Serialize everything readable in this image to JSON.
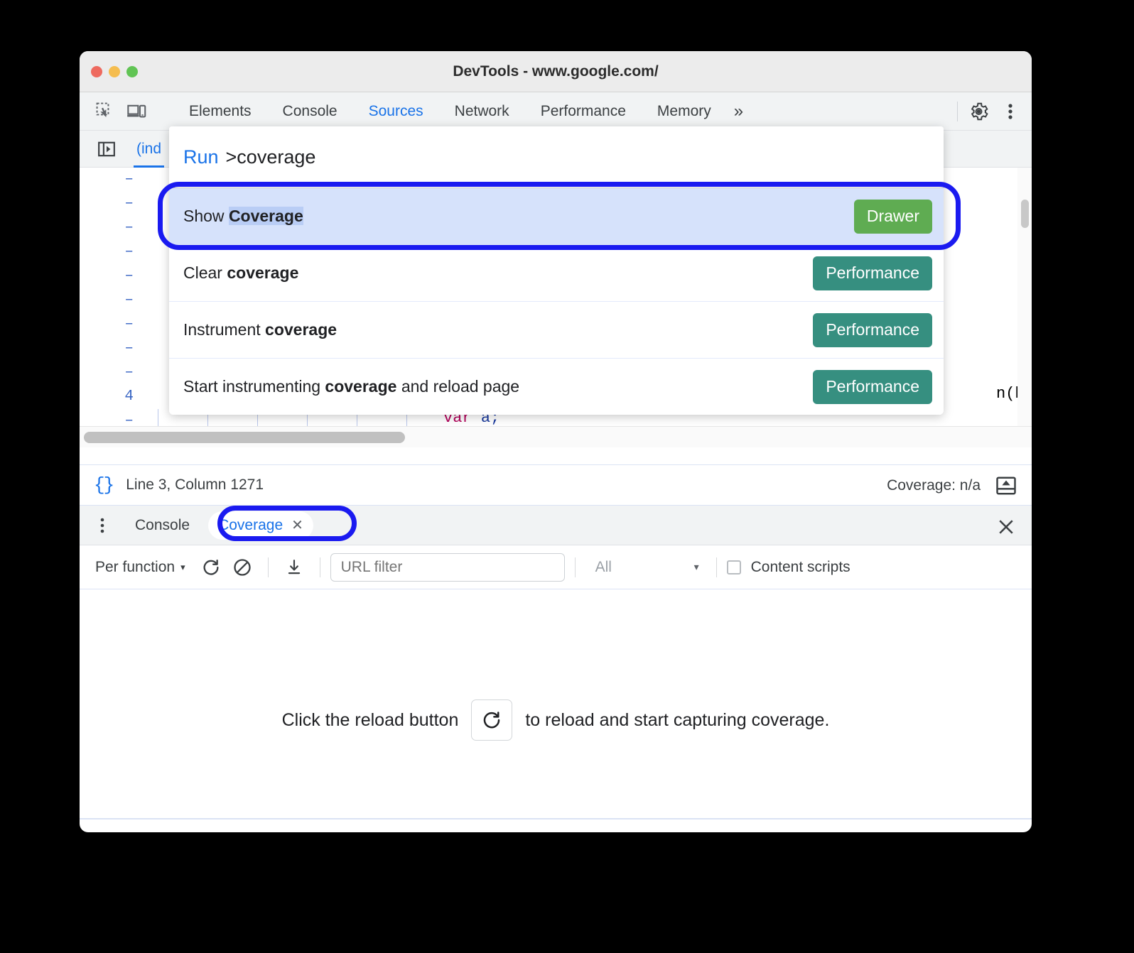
{
  "window": {
    "title": "DevTools - www.google.com/",
    "traffic_lights": [
      "close-red",
      "minimize-yellow",
      "maximize-green"
    ]
  },
  "main_tabbar": {
    "left_icons": [
      {
        "name": "inspect-element-icon",
        "label": "Inspect element"
      },
      {
        "name": "device-toolbar-icon",
        "label": "Toggle device toolbar"
      }
    ],
    "tabs": [
      {
        "label": "Elements",
        "selected": false
      },
      {
        "label": "Console",
        "selected": false
      },
      {
        "label": "Sources",
        "selected": true
      },
      {
        "label": "Network",
        "selected": false
      },
      {
        "label": "Performance",
        "selected": false
      },
      {
        "label": "Memory",
        "selected": false
      }
    ],
    "more_tabs": "»",
    "right_icons": [
      {
        "name": "gear-icon",
        "label": "Settings"
      },
      {
        "name": "kebab-menu-icon",
        "label": "Customize and control DevTools"
      }
    ]
  },
  "command_palette": {
    "prefix": "Run",
    "query": ">coverage",
    "items": [
      {
        "text_before": "Show ",
        "match": "Coverage",
        "text_after": "",
        "match_highlighted": true,
        "badge": "Drawer",
        "badge_color": "#5fac52",
        "selected": true
      },
      {
        "text_before": "Clear ",
        "match": "coverage",
        "text_after": "",
        "match_highlighted": false,
        "badge": "Performance",
        "badge_color": "#368f80",
        "selected": false
      },
      {
        "text_before": "Instrument ",
        "match": "coverage",
        "text_after": "",
        "match_highlighted": false,
        "badge": "Performance",
        "badge_color": "#368f80",
        "selected": false
      },
      {
        "text_before": "Start instrumenting ",
        "match": "coverage",
        "text_after": " and reload page",
        "match_highlighted": false,
        "badge": "Performance",
        "badge_color": "#368f80",
        "selected": false
      }
    ]
  },
  "sources": {
    "sidebar_toggle_icon": "show-navigator-icon",
    "file_tab": "(ind",
    "gutter": [
      "–",
      "–",
      "–",
      "–",
      "–",
      "–",
      "–",
      "–",
      "–",
      "4",
      "–"
    ],
    "code_fragment_right": "n(b) {",
    "code_line_var": "var a;",
    "code_tokens": {
      "keyword": "var",
      "identifier": "a",
      "terminator": ";"
    }
  },
  "sources_status": {
    "pretty_print_icon": "{}",
    "position": "Line 3, Column 1271",
    "coverage": "Coverage: n/a",
    "drawer_toggle_icon": "show-drawer-icon"
  },
  "drawer": {
    "kebab_icon": "more-tools-icon",
    "tabs": [
      {
        "label": "Console",
        "selected": false,
        "closable": false
      },
      {
        "label": "Coverage",
        "selected": true,
        "closable": true,
        "close_glyph": "✕"
      }
    ],
    "close_glyph": "✕"
  },
  "coverage_toolbar": {
    "mode": "Per function",
    "mode_caret": "▾",
    "reload_icon": "reload-icon",
    "clear_icon": "clear-icon",
    "export_icon": "download-icon",
    "url_filter_value": "",
    "url_filter_placeholder": "URL filter",
    "type_filter": "All",
    "type_filter_caret": "▾",
    "content_scripts_label": "Content scripts",
    "content_scripts_checked": false
  },
  "coverage_body": {
    "message_before": "Click the reload button",
    "reload_icon": "reload-icon",
    "message_after": "to reload and start capturing coverage."
  },
  "annotations": [
    {
      "name": "highlight-ring-show-coverage-row",
      "shape": "rounded-rect",
      "color": "#1a1af0"
    },
    {
      "name": "highlight-ring-coverage-tab",
      "shape": "rounded-rect",
      "color": "#1a1af0"
    }
  ]
}
